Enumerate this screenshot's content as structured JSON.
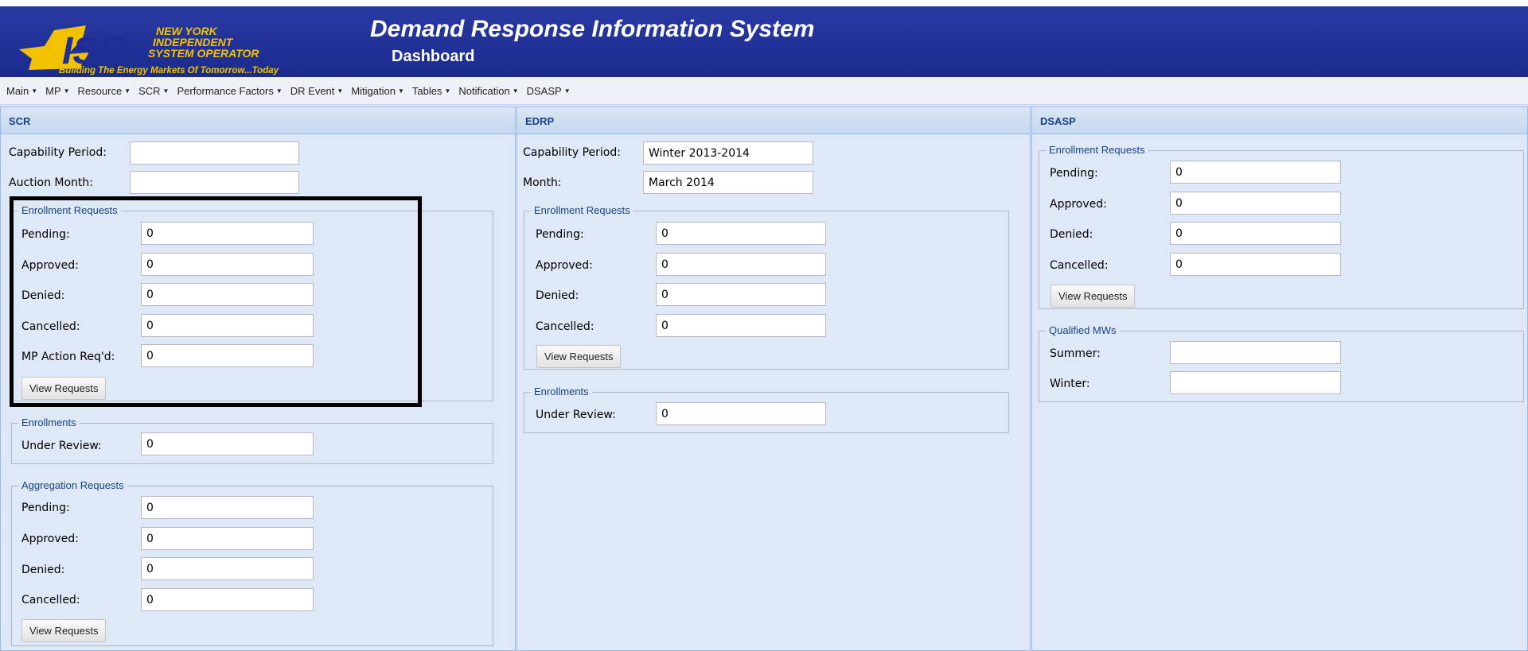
{
  "header": {
    "logo": {
      "line1": "NEW YORK",
      "line2": "INDEPENDENT",
      "line3": "SYSTEM OPERATOR",
      "tagline": "Building The Energy Markets Of Tomorrow...Today",
      "mark": "ISO"
    },
    "title": "Demand Response Information System",
    "subtitle": "Dashboard",
    "colors": {
      "background": "#1f2e96",
      "logo_yellow": "#f2c200"
    }
  },
  "menu": [
    {
      "label": "Main"
    },
    {
      "label": "MP"
    },
    {
      "label": "Resource"
    },
    {
      "label": "SCR"
    },
    {
      "label": "Performance Factors"
    },
    {
      "label": "DR Event"
    },
    {
      "label": "Mitigation"
    },
    {
      "label": "Tables"
    },
    {
      "label": "Notification"
    },
    {
      "label": "DSASP"
    }
  ],
  "scr": {
    "title": "SCR",
    "capability_period_label": "Capability Period:",
    "capability_period_value": "",
    "auction_month_label": "Auction Month:",
    "auction_month_value": "",
    "enrollment_requests": {
      "legend": "Enrollment Requests",
      "pending_label": "Pending:",
      "pending": "0",
      "approved_label": "Approved:",
      "approved": "0",
      "denied_label": "Denied:",
      "denied": "0",
      "cancelled_label": "Cancelled:",
      "cancelled": "0",
      "mp_action_label": "MP Action Req'd:",
      "mp_action": "0",
      "button": "View Requests"
    },
    "enrollments": {
      "legend": "Enrollments",
      "under_review_label": "Under Review:",
      "under_review": "0"
    },
    "aggregation_requests": {
      "legend": "Aggregation Requests",
      "pending_label": "Pending:",
      "pending": "0",
      "approved_label": "Approved:",
      "approved": "0",
      "denied_label": "Denied:",
      "denied": "0",
      "cancelled_label": "Cancelled:",
      "cancelled": "0",
      "button": "View Requests"
    }
  },
  "edrp": {
    "title": "EDRP",
    "capability_period_label": "Capability Period:",
    "capability_period_value": "Winter 2013-2014",
    "month_label": "Month:",
    "month_value": "March 2014",
    "enrollment_requests": {
      "legend": "Enrollment Requests",
      "pending_label": "Pending:",
      "pending": "0",
      "approved_label": "Approved:",
      "approved": "0",
      "denied_label": "Denied:",
      "denied": "0",
      "cancelled_label": "Cancelled:",
      "cancelled": "0",
      "button": "View Requests"
    },
    "enrollments": {
      "legend": "Enrollments",
      "under_review_label": "Under Review:",
      "under_review": "0"
    }
  },
  "dsasp": {
    "title": "DSASP",
    "enrollment_requests": {
      "legend": "Enrollment Requests",
      "pending_label": "Pending:",
      "pending": "0",
      "approved_label": "Approved:",
      "approved": "0",
      "denied_label": "Denied:",
      "denied": "0",
      "cancelled_label": "Cancelled:",
      "cancelled": "0",
      "button": "View Requests"
    },
    "qualified_mws": {
      "legend": "Qualified MWs",
      "summer_label": "Summer:",
      "summer": "",
      "winter_label": "Winter:",
      "winter": ""
    }
  }
}
